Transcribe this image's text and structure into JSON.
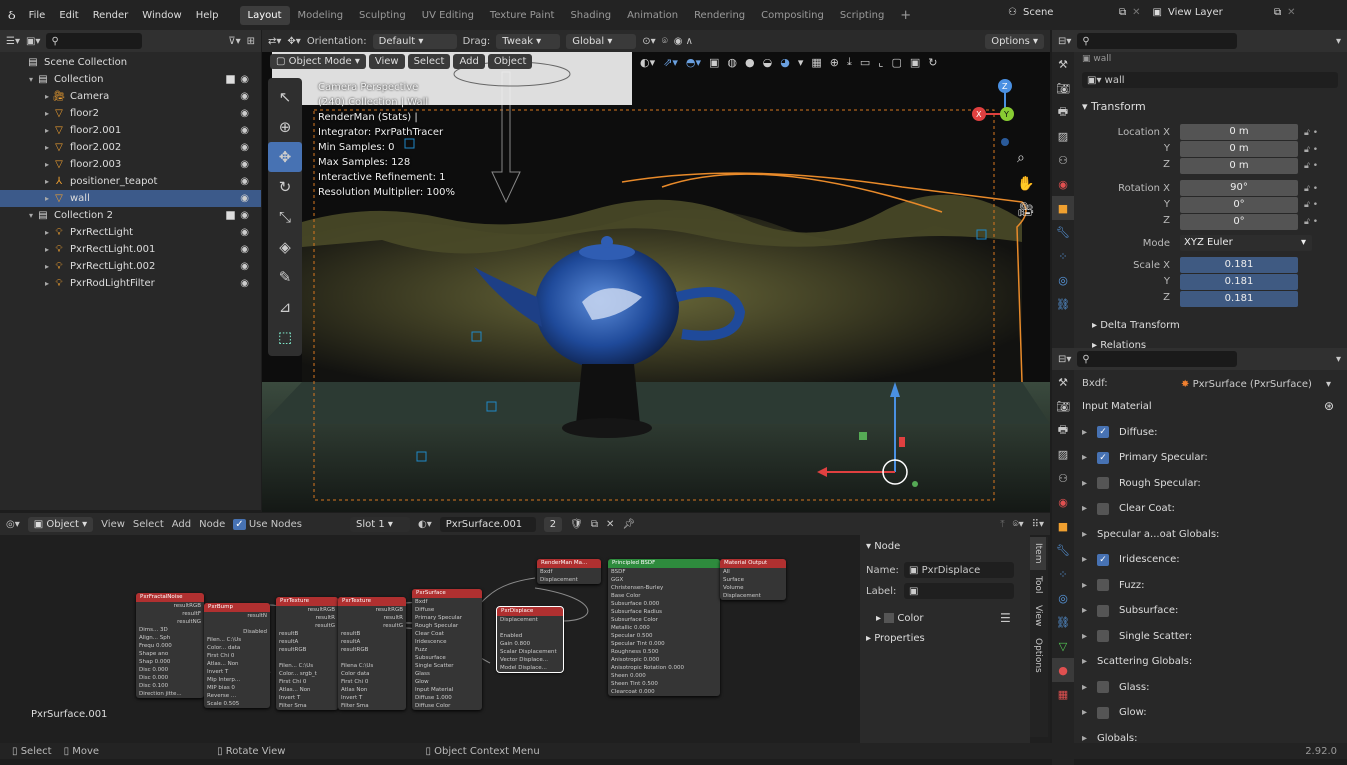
{
  "app": {
    "version": "2.92.0"
  },
  "topbar": {
    "menus": [
      "File",
      "Edit",
      "Render",
      "Window",
      "Help"
    ],
    "workspaces": [
      "Layout",
      "Modeling",
      "Sculpting",
      "UV Editing",
      "Texture Paint",
      "Shading",
      "Animation",
      "Rendering",
      "Compositing",
      "Scripting"
    ],
    "active_workspace": "Layout",
    "scene": "Scene",
    "view_layer": "View Layer"
  },
  "outliner": {
    "root": "Scene Collection",
    "items": [
      {
        "label": "Collection",
        "depth": 1,
        "kind": "collection"
      },
      {
        "label": "Camera",
        "depth": 2,
        "kind": "camera"
      },
      {
        "label": "floor2",
        "depth": 2,
        "kind": "mesh"
      },
      {
        "label": "floor2.001",
        "depth": 2,
        "kind": "mesh"
      },
      {
        "label": "floor2.002",
        "depth": 2,
        "kind": "mesh"
      },
      {
        "label": "floor2.003",
        "depth": 2,
        "kind": "mesh"
      },
      {
        "label": "positioner_teapot",
        "depth": 2,
        "kind": "empty"
      },
      {
        "label": "wall",
        "depth": 2,
        "kind": "mesh",
        "selected": true
      },
      {
        "label": "Collection 2",
        "depth": 1,
        "kind": "collection"
      },
      {
        "label": "PxrRectLight",
        "depth": 2,
        "kind": "light"
      },
      {
        "label": "PxrRectLight.001",
        "depth": 2,
        "kind": "light"
      },
      {
        "label": "PxrRectLight.002",
        "depth": 2,
        "kind": "light"
      },
      {
        "label": "PxrRodLightFilter",
        "depth": 2,
        "kind": "light"
      }
    ]
  },
  "viewport": {
    "orientation_label": "Orientation:",
    "orientation_value": "Default",
    "drag_label": "Drag:",
    "drag_value": "Tweak",
    "transform_space": "Global",
    "options": "Options",
    "mode": "Object Mode",
    "menus": [
      "View",
      "Select",
      "Add",
      "Object"
    ],
    "overlay": [
      "Camera Perspective",
      "(240) Collection | Wall",
      "RenderMan (Stats) |",
      "Integrator: PxrPathTracer",
      "Min Samples: 0",
      "Max Samples: 128",
      "Interactive Refinement: 1",
      "Resolution Multiplier: 100%"
    ]
  },
  "properties": {
    "object_name": "wall",
    "breadcrumb": "wall",
    "transform_title": "Transform",
    "location_label": "Location X",
    "location": [
      "0 m",
      "0 m",
      "0 m"
    ],
    "rotation_label": "Rotation X",
    "rotation": [
      "90°",
      "0°",
      "0°"
    ],
    "mode_label": "Mode",
    "mode_value": "XYZ Euler",
    "scale_label": "Scale X",
    "scale": [
      "0.181",
      "0.181",
      "0.181"
    ],
    "delta_transform": "Delta Transform",
    "relations": "Relations",
    "axis_labels": [
      "Y",
      "Z"
    ]
  },
  "material_panel": {
    "bxdf_label": "Bxdf:",
    "bxdf_value": "PxrSurface (PxrSurface)",
    "input_material": "Input Material",
    "rows": [
      {
        "label": "Diffuse:",
        "checked": true
      },
      {
        "label": "Primary Specular:",
        "checked": true
      },
      {
        "label": "Rough Specular:",
        "checked": false
      },
      {
        "label": "Clear Coat:",
        "checked": false
      },
      {
        "label": "Specular a...oat Globals:",
        "checked": null
      },
      {
        "label": "Iridescence:",
        "checked": true
      },
      {
        "label": "Fuzz:",
        "checked": false
      },
      {
        "label": "Subsurface:",
        "checked": false
      },
      {
        "label": "Single Scatter:",
        "checked": false
      },
      {
        "label": "Scattering Globals:",
        "checked": null
      },
      {
        "label": "Glass:",
        "checked": false
      },
      {
        "label": "Glow:",
        "checked": false
      },
      {
        "label": "Globals:",
        "checked": null
      }
    ]
  },
  "node_editor": {
    "type_label": "Object",
    "menus": [
      "View",
      "Select",
      "Add",
      "Node"
    ],
    "use_nodes": "Use Nodes",
    "slot": "Slot 1",
    "material": "PxrSurface.001",
    "users": "2",
    "tree_name": "PxrSurface.001",
    "sidebar": {
      "section": "Node",
      "name_label": "Name:",
      "name_value": "PxrDisplace",
      "label_label": "Label:",
      "color": "Color",
      "properties": "Properties",
      "tabs": [
        "Item",
        "Tool",
        "View",
        "Options"
      ]
    },
    "nodes": [
      {
        "title": "PxrFractalNoise",
        "color": "#b03030",
        "rows": [
          "resultRGB",
          "resultF",
          "resultNG",
          "Dims... 3D",
          "Align... Sph",
          "Frequ 0.000",
          "Shape ano",
          "Shap 0.000",
          "Disc 0.000",
          "Disc 0.000",
          "Disc 0.100",
          "Direction jitte..."
        ]
      },
      {
        "title": "PxrBump",
        "color": "#b03030",
        "rows": [
          "resultN",
          "",
          "Disabled",
          "Filen... C:\\Us",
          "Color... data",
          "First Chi 0",
          "Atlas... Non",
          "Invert T",
          "Mip Interp...",
          "MIP bias 0",
          "Reverse ...",
          "Scale 0.505"
        ]
      },
      {
        "title": "PxrTexture",
        "color": "#b03030",
        "rows": [
          "resultRGB",
          "resultR",
          "resultG",
          "resultB",
          "resultA",
          "resultRGB",
          "",
          "Filen... C:\\Us",
          "Color... srgb_t",
          "First Chi 0",
          "Atlas... Non",
          "Invert T",
          "Filter Sma"
        ]
      },
      {
        "title": "PxrTexture",
        "color": "#b03030",
        "rows": [
          "resultRGB",
          "resultR",
          "resultG",
          "resultB",
          "resultA",
          "resultRGB",
          "",
          "Filena C:\\Us",
          "Color data",
          "First Chi 0",
          "Atlas Non",
          "Invert T",
          "Filter Sma"
        ]
      },
      {
        "title": "PxrSurface",
        "color": "#b03030",
        "rows": [
          "Bxdf",
          "Diffuse",
          "Primary Specular",
          "Rough Specular",
          "Clear Coat",
          "Iridescence",
          "Fuzz",
          "Subsurface",
          "Single Scatter",
          "Glass",
          "Glow",
          "Input Material",
          "Diffuse 1.000",
          "Diffuse Color"
        ]
      },
      {
        "title": "PxrDisplace",
        "color": "#b03030",
        "rows": [
          "Displacement",
          "",
          "Enabled",
          "Gain 0.800",
          "Scalar Displacement",
          "Vector Displace...",
          "Model Displace..."
        ]
      },
      {
        "title": "RenderMan Ma...",
        "color": "#b03030",
        "rows": [
          "Bxdf",
          "Displacement"
        ]
      },
      {
        "title": "Principled BSDF",
        "color": "#2e8b3d",
        "rows": [
          "BSDF",
          "GGX",
          "Christensen-Burley",
          "Base Color",
          "Subsurface 0.000",
          "Subsurface Radius",
          "Subsurface Color",
          "Metallic 0.000",
          "Specular 0.500",
          "Specular Tint 0.000",
          "Roughness 0.500",
          "Anisotropic 0.000",
          "Anisotropic Rotation 0.000",
          "Sheen 0.000",
          "Sheen Tint 0.500",
          "Clearcoat 0.000"
        ]
      },
      {
        "title": "Material Output",
        "color": "#b03030",
        "rows": [
          "All",
          "Surface",
          "Volume",
          "Displacement"
        ]
      }
    ]
  },
  "statusbar": {
    "select": "Select",
    "move": "Move",
    "rotate": "Rotate View",
    "context": "Object Context Menu",
    "version": "2.92.0"
  }
}
